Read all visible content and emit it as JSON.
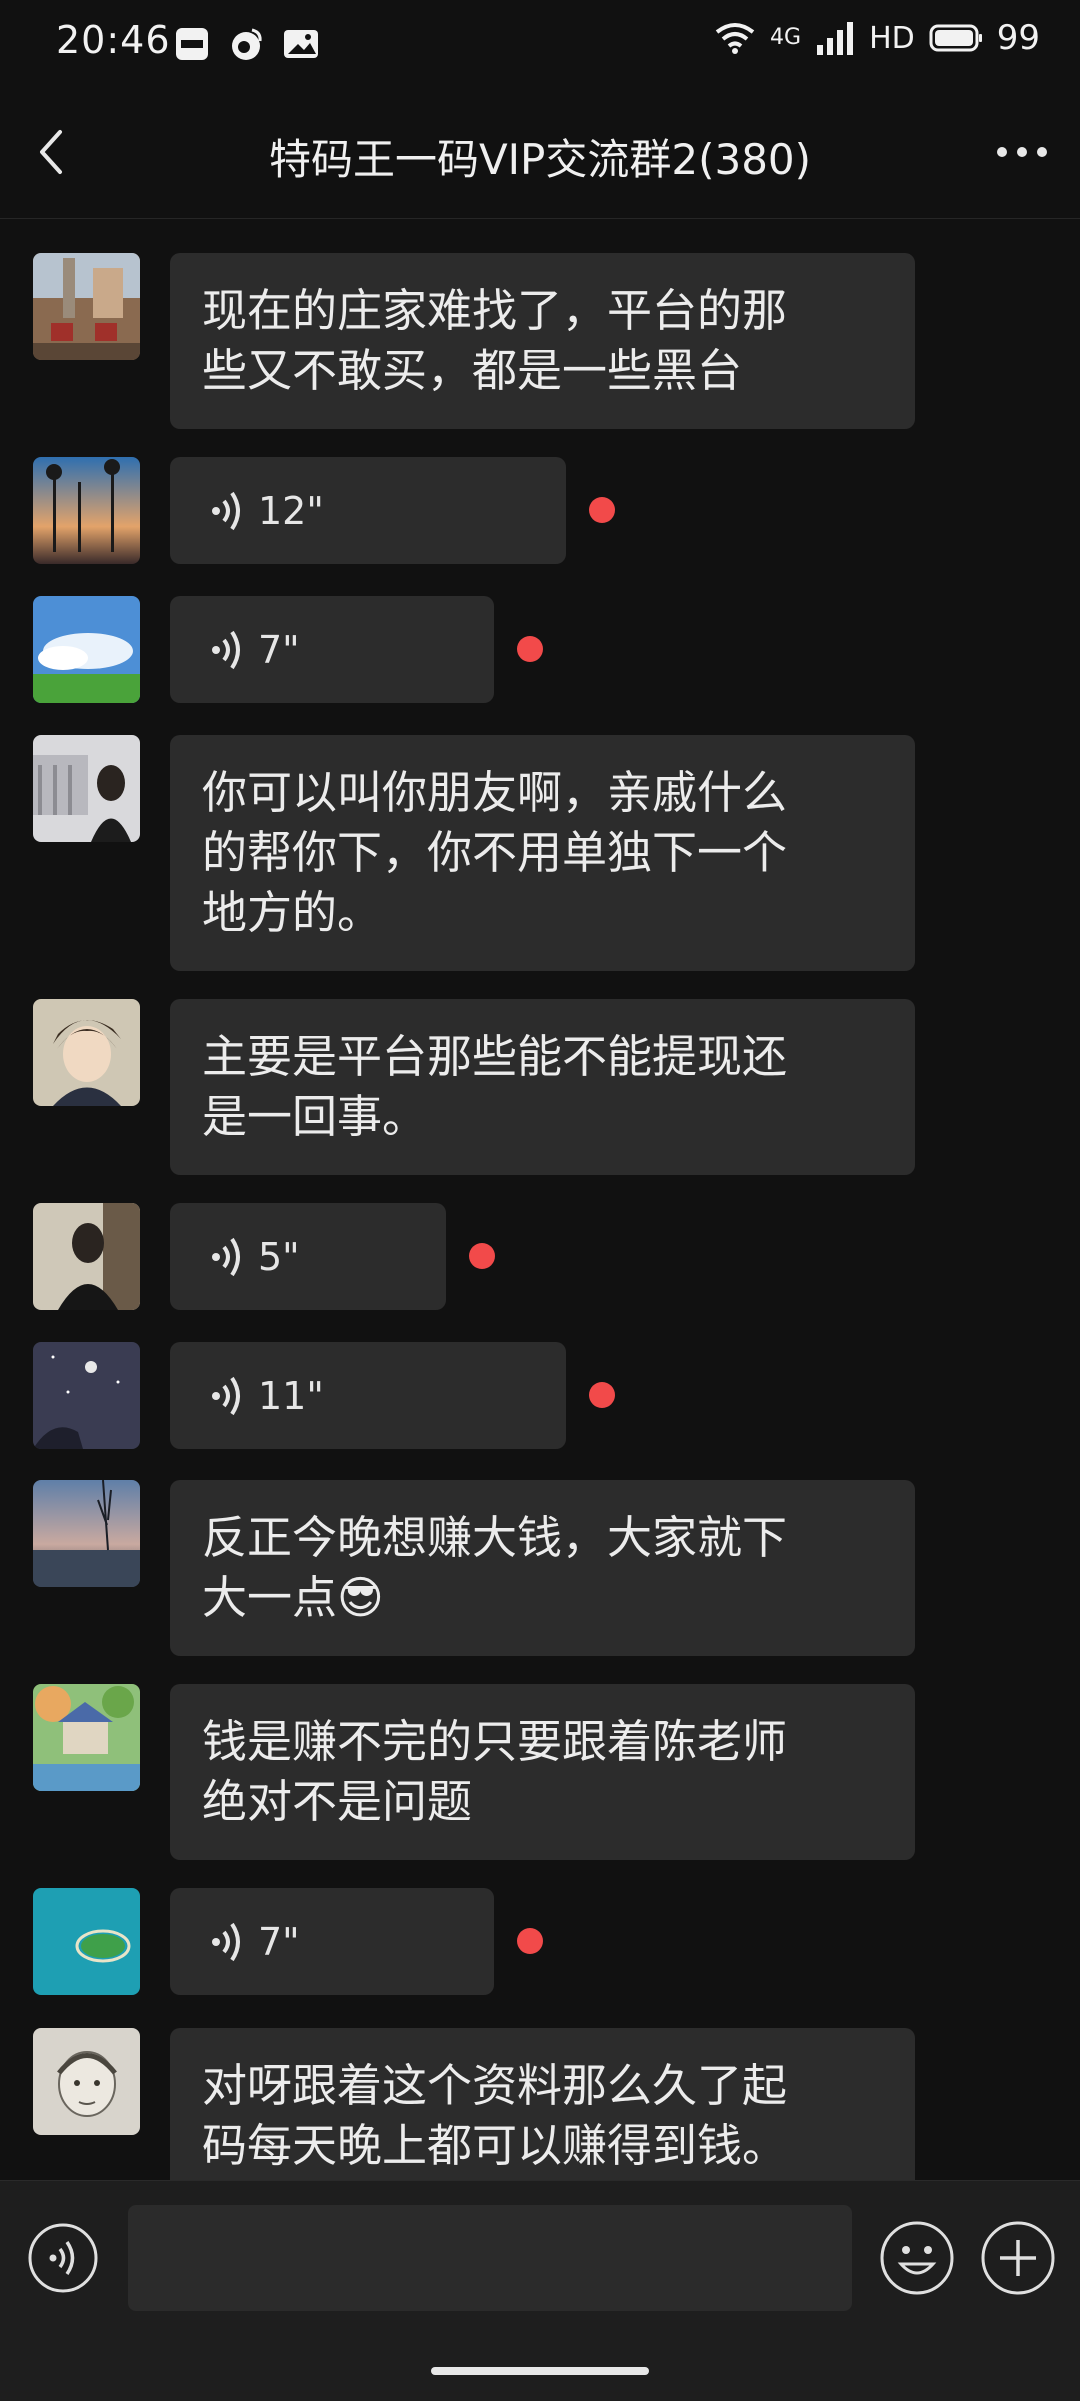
{
  "status_bar": {
    "time": "20:46",
    "network_type": "4G",
    "hd_label": "HD",
    "battery": "99",
    "icons": [
      "xiaohongshu-icon",
      "weibo-icon",
      "gallery-icon",
      "wifi-icon",
      "signal-icon",
      "battery-icon"
    ]
  },
  "header": {
    "title": "特码王一码VIP交流群2(380)",
    "back_icon": "chevron-left-icon",
    "more_icon": "more-dots-icon"
  },
  "messages": [
    {
      "type": "text",
      "avatar": "avatar-street-cafe",
      "text": "现在的庄家难找了，平台的那\n些又不敢买，都是一些黑台"
    },
    {
      "type": "voice",
      "avatar": "avatar-palm-sunset",
      "duration": "12\"",
      "unread": true
    },
    {
      "type": "voice",
      "avatar": "avatar-sky-grass",
      "duration": "7\"",
      "unread": true
    },
    {
      "type": "text",
      "avatar": "avatar-girl-building",
      "text": "你可以叫你朋友啊，亲戚什么\n的帮你下，你不用单独下一个\n地方的。"
    },
    {
      "type": "text",
      "avatar": "avatar-anime-boy",
      "text": "主要是平台那些能不能提现还\n是一回事。"
    },
    {
      "type": "voice",
      "avatar": "avatar-selfie",
      "duration": "5\"",
      "unread": true
    },
    {
      "type": "voice",
      "avatar": "avatar-night-sky",
      "duration": "11\"",
      "unread": true
    },
    {
      "type": "text",
      "avatar": "avatar-lake-dusk",
      "text": "反正今晚想赚大钱，大家就下\n大一点😎"
    },
    {
      "type": "text",
      "avatar": "avatar-cottage",
      "text": "钱是赚不完的只要跟着陈老师\n绝对不是问题"
    },
    {
      "type": "voice",
      "avatar": "avatar-island",
      "duration": "7\"",
      "unread": true
    },
    {
      "type": "text",
      "avatar": "avatar-sketch-child",
      "text": "对呀跟着这个资料那么久了起\n码每天晚上都可以赚得到钱。"
    }
  ],
  "input_bar": {
    "voice_toggle_icon": "voice-toggle-icon",
    "emoji_icon": "emoji-icon",
    "plus_icon": "plus-icon"
  },
  "colors": {
    "background": "#111111",
    "bubble": "#2c2c2c",
    "unread_dot": "#f24a4a",
    "input_bar": "#1e1e1e"
  }
}
